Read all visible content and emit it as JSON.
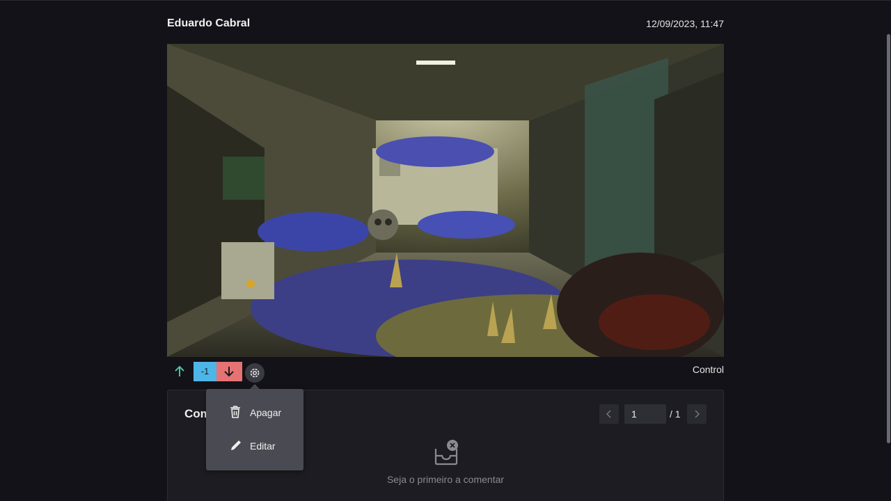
{
  "post": {
    "author": "Eduardo Cabral",
    "timestamp": "12/09/2023, 11:47",
    "category": "Control"
  },
  "votes": {
    "score": "-1",
    "up_icon": "arrow-up-icon",
    "down_icon": "arrow-down-icon",
    "settings_icon": "gear-icon",
    "colors": {
      "up": "#4fc3a1",
      "score_bg": "#4db6e6",
      "down_bg": "#e57373"
    }
  },
  "context_menu": {
    "items": [
      {
        "label": "Apagar",
        "icon": "trash-icon"
      },
      {
        "label": "Editar",
        "icon": "pencil-icon"
      }
    ]
  },
  "comments": {
    "title": "Comentários",
    "page_current": "1",
    "page_total": "/ 1",
    "empty_text": "Seja o primeiro a comentar",
    "empty_icon": "inbox-empty-icon"
  }
}
